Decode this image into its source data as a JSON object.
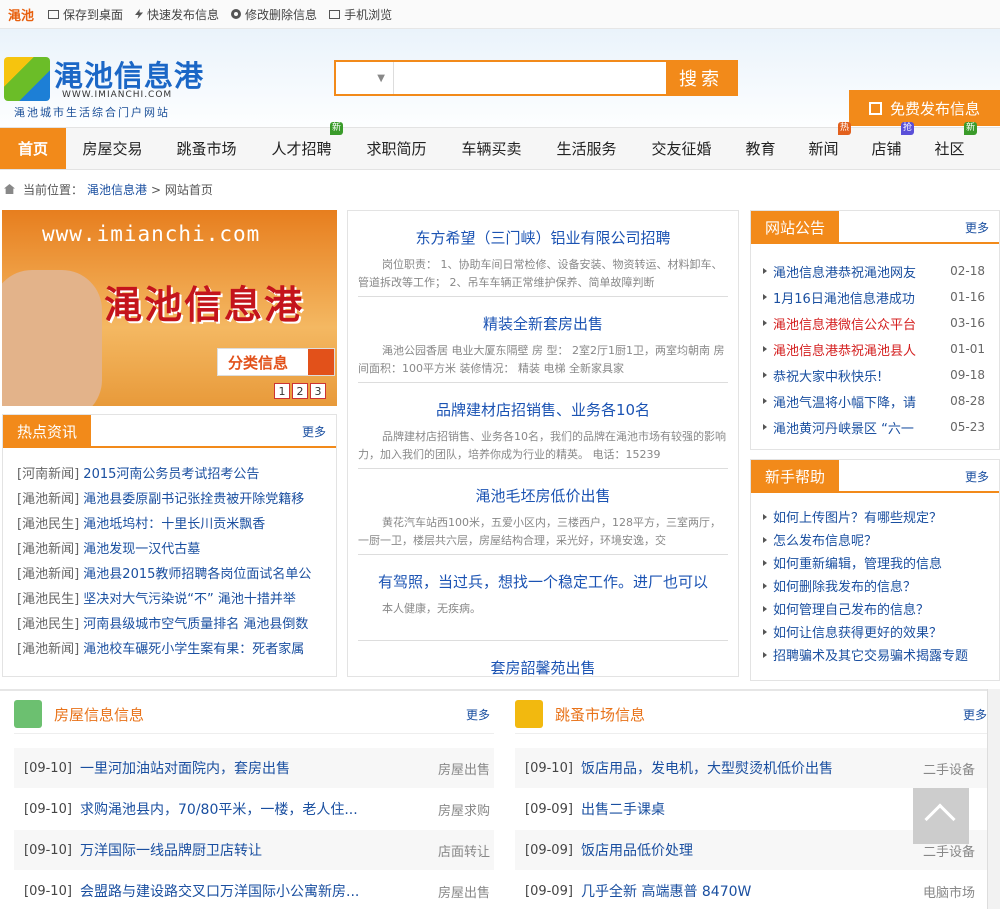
{
  "topbar": {
    "city": "渑池",
    "links": [
      "保存到桌面",
      "快速发布信息",
      "修改删除信息",
      "手机浏览"
    ]
  },
  "logo": {
    "name": "渑池信息港",
    "url": "WWW.IMIANCHI.COM",
    "slogan": "渑池城市生活综合门户网站"
  },
  "search": {
    "placeholder": "",
    "button": "搜索"
  },
  "publish_button": "免费发布信息",
  "nav": [
    {
      "label": "首页",
      "badge": ""
    },
    {
      "label": "房屋交易",
      "badge": ""
    },
    {
      "label": "跳蚤市场",
      "badge": ""
    },
    {
      "label": "人才招聘",
      "badge": "新"
    },
    {
      "label": "求职简历",
      "badge": ""
    },
    {
      "label": "车辆买卖",
      "badge": ""
    },
    {
      "label": "生活服务",
      "badge": ""
    },
    {
      "label": "交友征婚",
      "badge": ""
    },
    {
      "label": "教育",
      "badge": ""
    },
    {
      "label": "新闻",
      "badge": "热"
    },
    {
      "label": "店铺",
      "badge": "抢"
    },
    {
      "label": "社区",
      "badge": "新"
    }
  ],
  "breadcrumb": {
    "prefix": "当前位置：",
    "site": "渑池信息港",
    "current": "> 网站首页"
  },
  "banner": {
    "url": "www.imianchi.com",
    "title": "渑池信息港",
    "category": "分类信息",
    "pages": [
      "1",
      "2",
      "3"
    ]
  },
  "hot": {
    "title": "热点资讯",
    "more": "更多",
    "items": [
      {
        "tag": "[河南新闻]",
        "text": "2015河南公务员考试招考公告"
      },
      {
        "tag": "[渑池新闻]",
        "text": "渑池县委原副书记张拴贵被开除党籍移"
      },
      {
        "tag": "[渑池民生]",
        "text": "渑池坻坞村：十里长川贡米飘香"
      },
      {
        "tag": "[渑池新闻]",
        "text": "渑池发现一汉代古墓"
      },
      {
        "tag": "[渑池新闻]",
        "text": "渑池县2015教师招聘各岗位面试名单公"
      },
      {
        "tag": "[渑池民生]",
        "text": "坚决对大气污染说“不” 渑池十措并举"
      },
      {
        "tag": "[渑池民生]",
        "text": "河南县级城市空气质量排名 渑池县倒数"
      },
      {
        "tag": "[渑池新闻]",
        "text": "渑池校车碾死小学生案有果：死者家属"
      }
    ]
  },
  "articles": [
    {
      "title": "东方希望（三门峡）铝业有限公司招聘",
      "body": "岗位职责： 1、协助车间日常检修、设备安装、物资转运、材料卸车、管道拆改等工作； 2、吊车车辆正常维护保养、简单故障判断"
    },
    {
      "title": "精装全新套房出售",
      "body": "渑池公园香居 电业大厦东隔壁 房 型： 2室2厅1厨1卫，两室均朝南 房间面积：100平方米 装修情况： 精装 电梯 全新家具家"
    },
    {
      "title": "品牌建材店招销售、业务各10名",
      "body": "品牌建材店招销售、业务各10名，我们的品牌在渑池市场有较强的影响力，加入我们的团队，培养你成为行业的精英。 电话：15239"
    },
    {
      "title": "渑池毛坯房低价出售",
      "body": "黄花汽车站西100米，五爱小区内，三楼西户，128平方，三室两厅，一厨一卫，楼层共六层，房屋结构合理，采光好，环境安逸，交"
    },
    {
      "title": "有驾照，当过兵，想找一个稳定工作。进厂也可以",
      "body": "本人健康，无疾病。"
    },
    {
      "title": "套房韶馨苑出售",
      "body": ""
    }
  ],
  "notice": {
    "title": "网站公告",
    "more": "更多",
    "items": [
      {
        "text": "渑池信息港恭祝渑池网友",
        "date": "02-18",
        "red": false
      },
      {
        "text": "1月16日渑池信息港成功",
        "date": "01-16",
        "red": false
      },
      {
        "text": "渑池信息港微信公众平台",
        "date": "03-16",
        "red": true
      },
      {
        "text": "渑池信息港恭祝渑池县人",
        "date": "01-01",
        "red": true
      },
      {
        "text": "恭祝大家中秋快乐!",
        "date": "09-18",
        "red": false
      },
      {
        "text": "渑池气温将小幅下降，请",
        "date": "08-28",
        "red": false
      },
      {
        "text": "渑池黄河丹峡景区 “六一",
        "date": "05-23",
        "red": false
      }
    ]
  },
  "help": {
    "title": "新手帮助",
    "more": "更多",
    "items": [
      "如何上传图片？有哪些规定？",
      "怎么发布信息呢？",
      "如何重新编辑，管理我的信息",
      "如何删除我发布的信息？",
      "如何管理自己发布的信息？",
      "如何让信息获得更好的效果？",
      "招聘骗术及其它交易骗术揭露专题"
    ]
  },
  "house": {
    "title": "房屋信息信息",
    "more": "更多",
    "icon_color": "#6cc070",
    "rows": [
      {
        "date": "[09-10]",
        "text": "一里河加油站对面院内，套房出售",
        "cat": "房屋出售"
      },
      {
        "date": "[09-10]",
        "text": "求购渑池县内，70/80平米，一楼，老人住...",
        "cat": "房屋求购"
      },
      {
        "date": "[09-10]",
        "text": "万洋国际一线品牌厨卫店转让",
        "cat": "店面转让"
      },
      {
        "date": "[09-10]",
        "text": "会盟路与建设路交叉口万洋国际小公寓新房...",
        "cat": "房屋出售"
      }
    ]
  },
  "market": {
    "title": "跳蚤市场信息",
    "more": "更多",
    "icon_color": "#f2b90f",
    "rows": [
      {
        "date": "[09-10]",
        "text": "饭店用品，发电机，大型熨烫机低价出售",
        "cat": "二手设备"
      },
      {
        "date": "[09-09]",
        "text": "出售二手课桌",
        "cat": ""
      },
      {
        "date": "[09-09]",
        "text": "饭店用品低价处理",
        "cat": "二手设备"
      },
      {
        "date": "[09-09]",
        "text": "几乎全新 高端惠普 8470W",
        "cat": "电脑市场"
      }
    ]
  }
}
